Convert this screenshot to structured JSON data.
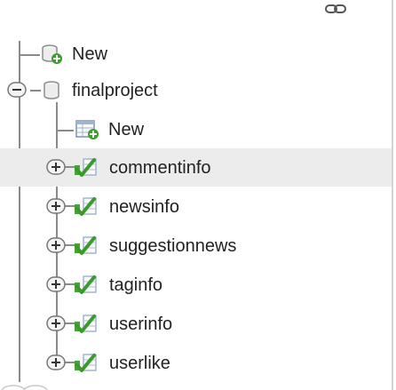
{
  "tree": {
    "root_new": {
      "label": "New",
      "icon": "database-add-icon"
    },
    "database": {
      "label": "finalproject",
      "icon": "database-icon",
      "expanded": true
    },
    "db_new": {
      "label": "New",
      "icon": "table-add-icon"
    },
    "tables": [
      {
        "label": "commentinfo",
        "icon": "table-icon",
        "expanded": false
      },
      {
        "label": "newsinfo",
        "icon": "table-icon",
        "expanded": false
      },
      {
        "label": "suggestionnews",
        "icon": "table-icon",
        "expanded": false
      },
      {
        "label": "taginfo",
        "icon": "table-icon",
        "expanded": false
      },
      {
        "label": "userinfo",
        "icon": "table-icon",
        "expanded": false
      },
      {
        "label": "userlike",
        "icon": "table-icon",
        "expanded": false
      }
    ],
    "hovered_table_index": 0
  },
  "toolbar": {
    "link_icon": "chain-link-icon"
  },
  "colors": {
    "guide_line": "#8a8a8a",
    "hover_bg": "#ececec",
    "add_badge": "#3aa02c",
    "table_check": "#3a9a2a"
  }
}
